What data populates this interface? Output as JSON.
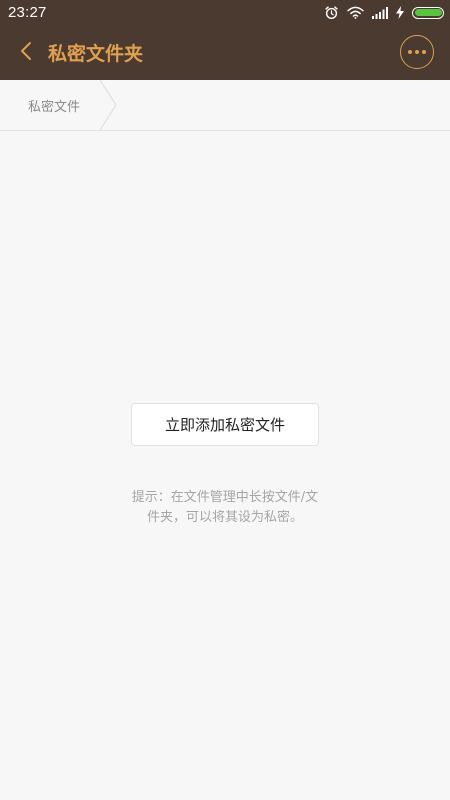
{
  "status_bar": {
    "time": "23:27",
    "icons": [
      "alarm-icon",
      "wifi-icon",
      "signal-icon",
      "charging-icon",
      "battery-icon"
    ],
    "battery_level": 1.0
  },
  "header": {
    "back_icon": "chevron-left-icon",
    "title": "私密文件夹",
    "more_icon": "more-icon"
  },
  "breadcrumb": {
    "items": [
      {
        "label": "私密文件"
      }
    ]
  },
  "main": {
    "add_button_label": "立即添加私密文件",
    "hint_line1": "提示：在文件管理中长按文件/文",
    "hint_line2": "件夹，可以将其设为私密。"
  },
  "colors": {
    "header_bg": "#4a3a30",
    "accent": "#e0a04e",
    "background": "#f7f7f7",
    "battery": "#5ac43e"
  }
}
